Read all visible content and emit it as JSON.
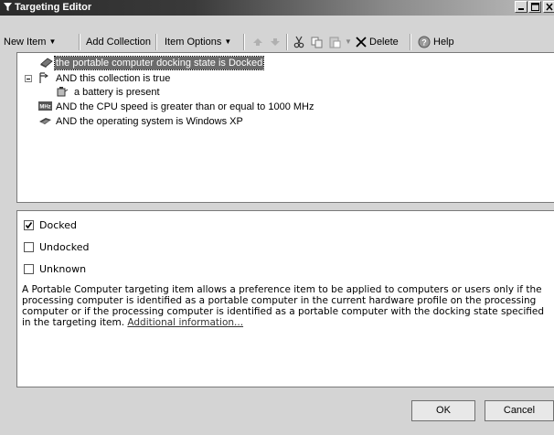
{
  "window": {
    "title": "Targeting Editor",
    "controls": {
      "minimize": "_",
      "maximize": "□",
      "close": "X"
    }
  },
  "toolbar": {
    "new_item": "New Item",
    "add_collection": "Add Collection",
    "item_options": "Item Options",
    "delete": "Delete",
    "help": "Help"
  },
  "tree": {
    "items": [
      {
        "label": "the portable computer docking state is Docked",
        "icon": "portable-computer-icon",
        "selected": true
      },
      {
        "label": "AND this collection is true",
        "icon": "collection-icon",
        "expanded": true
      },
      {
        "label": "a battery is present",
        "icon": "battery-icon"
      },
      {
        "label": "AND the CPU speed is greater than or equal to 1000 MHz",
        "icon": "cpu-mhz-icon",
        "icon_text": "MHz"
      },
      {
        "label": "AND the operating system is Windows XP",
        "icon": "operating-system-icon"
      }
    ]
  },
  "properties": {
    "options": [
      {
        "label": "Docked",
        "checked": true
      },
      {
        "label": "Undocked",
        "checked": false
      },
      {
        "label": "Unknown",
        "checked": false
      }
    ],
    "description": "A Portable Computer targeting item allows a preference item to be applied to computers or users only if the processing computer is identified as a portable computer in the current hardware profile on the processing computer or if the processing computer is identified as a portable computer with the docking state specified in the targeting item.",
    "link": "Additional information..."
  },
  "buttons": {
    "ok": "OK",
    "cancel": "Cancel"
  },
  "colors": {
    "selection": "#6b6b6b",
    "titlebar_dark": "#2b2b2b",
    "background": "#d4d4d4"
  }
}
